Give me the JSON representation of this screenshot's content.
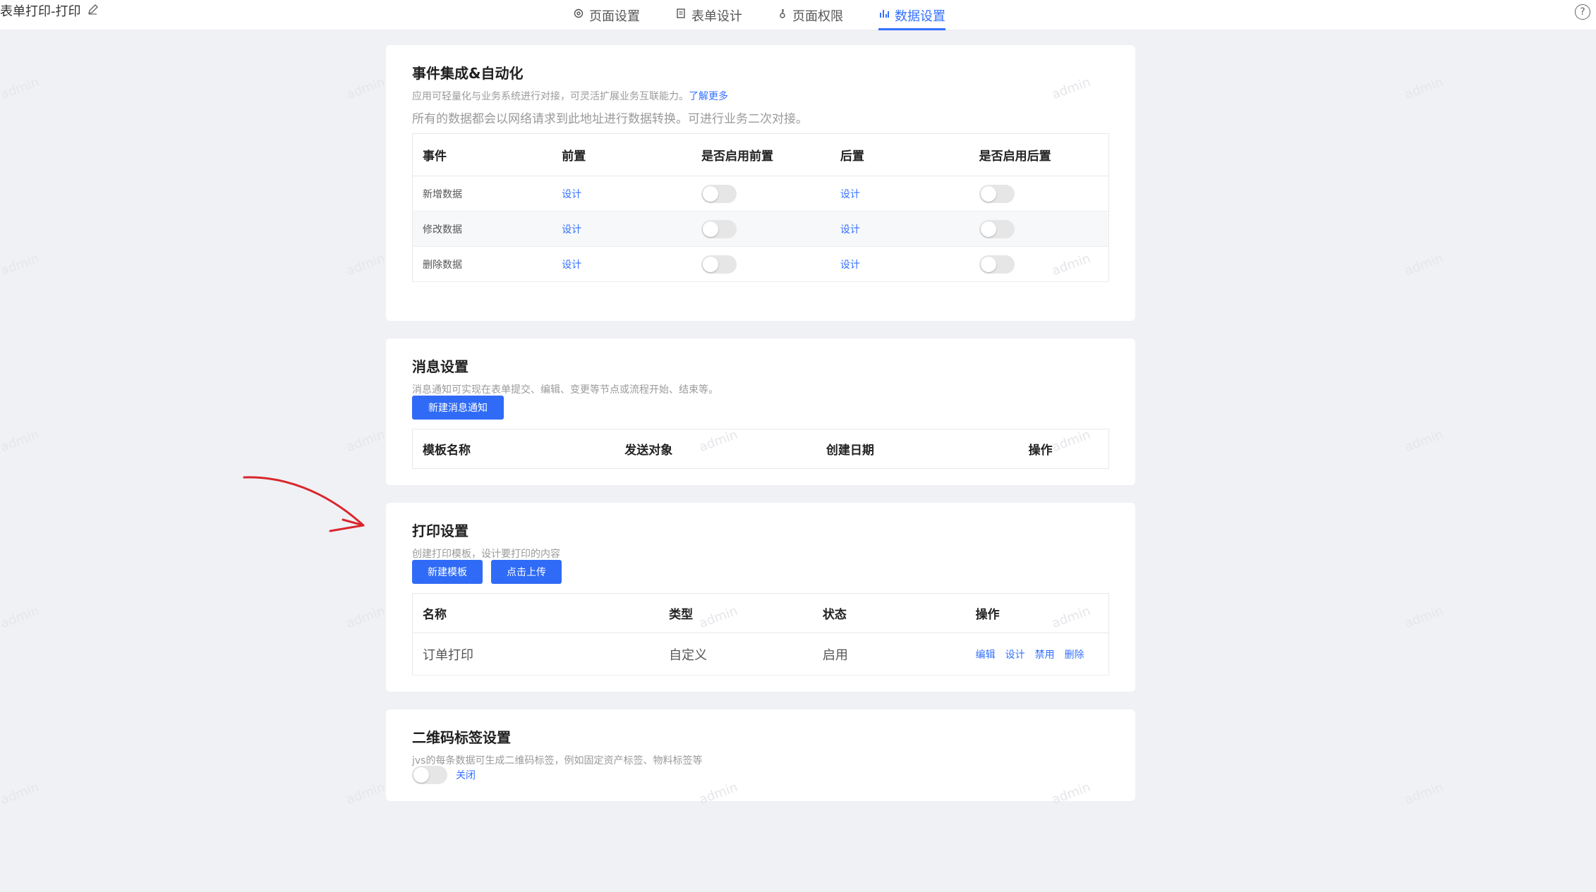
{
  "header": {
    "form_title": "表单打印-打印",
    "tabs": [
      {
        "label": "页面设置",
        "icon": "gear-icon"
      },
      {
        "label": "表单设计",
        "icon": "document-icon"
      },
      {
        "label": "页面权限",
        "icon": "key-icon"
      },
      {
        "label": "数据设置",
        "icon": "bar-chart-icon",
        "active": true
      }
    ],
    "help": "?"
  },
  "events": {
    "title": "事件集成&自动化",
    "desc": "应用可轻量化与业务系统进行对接，可灵活扩展业务互联能力。",
    "learn_more": "了解更多",
    "desc2": "所有的数据都会以网络请求到此地址进行数据转换。可进行业务二次对接。",
    "columns": [
      "事件",
      "前置",
      "是否启用前置",
      "后置",
      "是否启用后置"
    ],
    "rows": [
      {
        "event": "新增数据",
        "pre": "设计",
        "post": "设计"
      },
      {
        "event": "修改数据",
        "pre": "设计",
        "post": "设计"
      },
      {
        "event": "删除数据",
        "pre": "设计",
        "post": "设计"
      }
    ]
  },
  "messages": {
    "title": "消息设置",
    "desc": "消息通知可实现在表单提交、编辑、变更等节点或流程开始、结束等。",
    "new_button": "新建消息通知",
    "columns": [
      "模板名称",
      "发送对象",
      "创建日期",
      "操作"
    ]
  },
  "print": {
    "title": "打印设置",
    "desc": "创建打印模板，设计要打印的内容",
    "new_button": "新建模板",
    "upload_button": "点击上传",
    "columns": [
      "名称",
      "类型",
      "状态",
      "操作"
    ],
    "rows": [
      {
        "name": "订单打印",
        "type": "自定义",
        "status": "启用",
        "ops": [
          "编辑",
          "设计",
          "禁用",
          "删除"
        ]
      }
    ]
  },
  "qrcode": {
    "title": "二维码标签设置",
    "desc": "jvs的每条数据可生成二维码标签，例如固定资产标签、物料标签等",
    "switch_label": "关闭"
  },
  "watermark": "admin",
  "colors": {
    "accent": "#3370ff",
    "button": "#2f6bf6",
    "annotation": "#d9262b"
  }
}
